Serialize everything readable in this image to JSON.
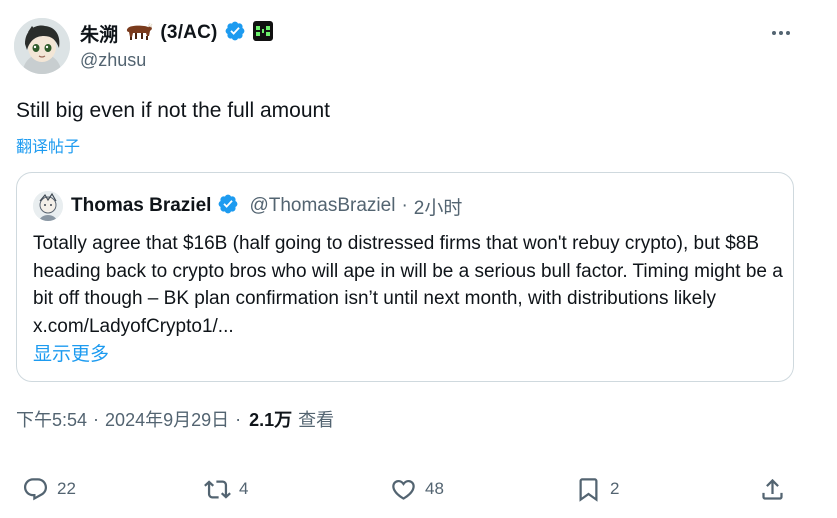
{
  "author": {
    "display_name": "朱溯",
    "tag": "(3/AC)",
    "handle": "@zhusu",
    "more_label": "More"
  },
  "tweet": {
    "text": "Still big even if not the full amount",
    "translate_label": "翻译帖子"
  },
  "quote": {
    "display_name": "Thomas Braziel",
    "handle": "@ThomasBraziel",
    "separator": "·",
    "time": "2小时",
    "text": "Totally agree that $16B (half going to distressed firms that won't rebuy crypto), but $8B heading back to crypto bros who will ape in will be a serious bull factor. Timing might be a bit off though – BK plan confirmation isn’t until next month, with distributions likely x.com/LadyofCrypto1/...",
    "show_more_label": "显示更多"
  },
  "meta": {
    "time": "下午5:54",
    "sep1": "·",
    "date": "2024年9月29日",
    "sep2": "·",
    "views": "2.1万",
    "views_label": "查看"
  },
  "actions": {
    "replies": "22",
    "reposts": "4",
    "likes": "48",
    "bookmarks": "2"
  },
  "colors": {
    "accent": "#1d9bf0",
    "secondary_text": "#536471",
    "border": "#cfd9de",
    "verified": "#1d9bf0"
  }
}
